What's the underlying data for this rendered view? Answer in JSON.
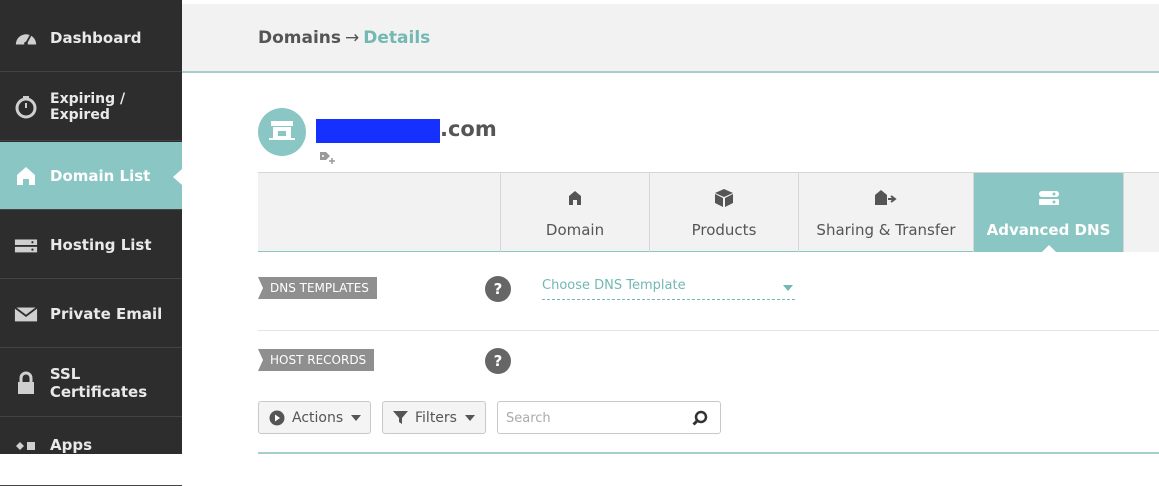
{
  "sidebar": {
    "items": [
      {
        "label": "Dashboard",
        "icon": "speedometer-icon"
      },
      {
        "label": "Expiring / Expired",
        "icon": "stopwatch-icon"
      },
      {
        "label": "Domain List",
        "icon": "house-icon",
        "active": true
      },
      {
        "label": "Hosting List",
        "icon": "server-icon"
      },
      {
        "label": "Private Email",
        "icon": "envelope-icon"
      },
      {
        "label": "SSL Certificates",
        "icon": "lock-icon"
      },
      {
        "label": "Apps",
        "icon": "apps-icon"
      }
    ]
  },
  "header": {
    "breadcrumb_root": "Domains",
    "breadcrumb_sep": "→",
    "breadcrumb_current": "Details"
  },
  "domain": {
    "name_suffix": ".com"
  },
  "tabs": [
    {
      "label": "Domain",
      "icon": "house-icon"
    },
    {
      "label": "Products",
      "icon": "box-icon"
    },
    {
      "label": "Sharing & Transfer",
      "icon": "transfer-icon"
    },
    {
      "label": "Advanced DNS",
      "icon": "dns-icon",
      "active": true
    }
  ],
  "sections": {
    "dns_templates": "DNS TEMPLATES",
    "host_records": "HOST RECORDS",
    "help_glyph": "?"
  },
  "dns_template_select": {
    "value": "Choose DNS Template"
  },
  "toolbar": {
    "actions_label": "Actions",
    "filters_label": "Filters",
    "search_placeholder": "Search"
  },
  "colors": {
    "accent": "#8ac6c3",
    "sidebar_bg": "#2d2d2d",
    "redaction": "#1530ff"
  }
}
